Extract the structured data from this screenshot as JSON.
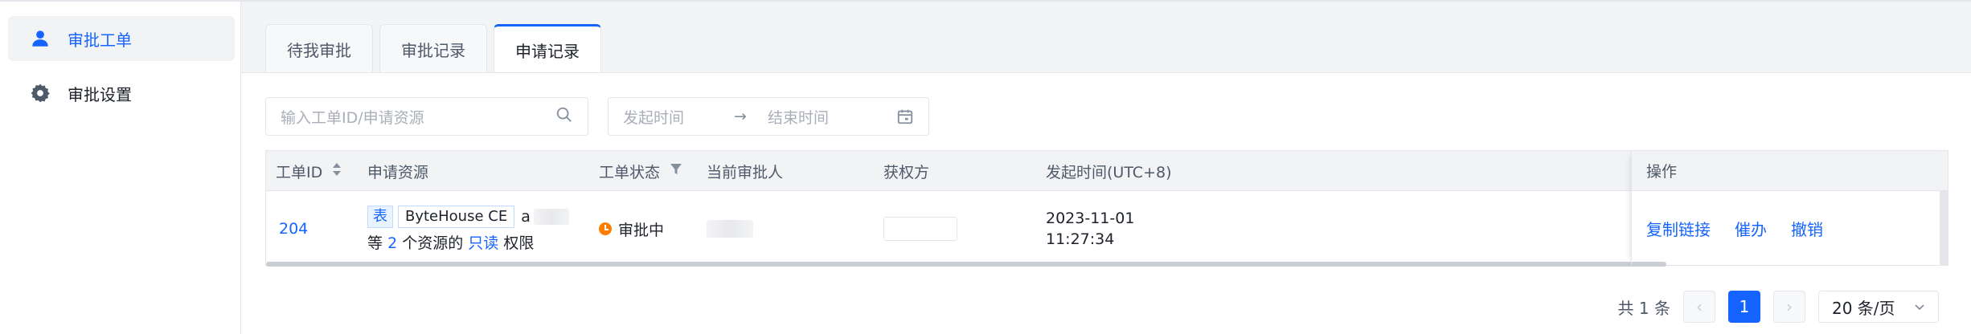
{
  "sidebar": {
    "items": [
      {
        "label": "审批工单",
        "icon": "user-icon",
        "active": true
      },
      {
        "label": "审批设置",
        "icon": "gear-icon",
        "active": false
      }
    ]
  },
  "tabs": [
    {
      "label": "待我审批",
      "active": false
    },
    {
      "label": "审批记录",
      "active": false
    },
    {
      "label": "申请记录",
      "active": true
    }
  ],
  "filters": {
    "search_placeholder": "输入工单ID/申请资源",
    "start_placeholder": "发起时间",
    "range_arrow": "→",
    "end_placeholder": "结束时间"
  },
  "table": {
    "columns": {
      "id": "工单ID",
      "resource": "申请资源",
      "status": "工单状态",
      "approver": "当前审批人",
      "grantee": "获权方",
      "created": "发起时间(UTC+8)",
      "actions": "操作"
    },
    "rows": [
      {
        "id": "204",
        "resource_tag": "表",
        "resource_name": "ByteHouse CE",
        "resource_suffix": "a",
        "resource_line2_prefix": "等",
        "resource_count": "2",
        "resource_line2_mid": "个资源的",
        "permission": "只读",
        "resource_line2_end": "权限",
        "status": "审批中",
        "created_date": "2023-11-01",
        "created_time": "11:27:34",
        "actions": [
          "复制链接",
          "催办",
          "撤销"
        ]
      }
    ]
  },
  "pagination": {
    "total": "共 1 条",
    "prev": "‹",
    "current": "1",
    "next": "›",
    "page_size": "20 条/页"
  },
  "colors": {
    "accent": "#1664ff",
    "status_pending": "#ff7d00"
  }
}
